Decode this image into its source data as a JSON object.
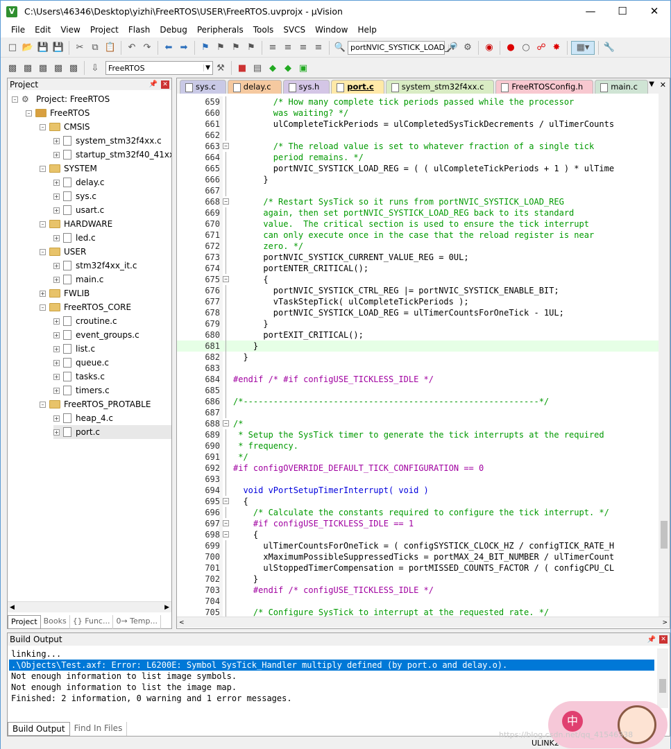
{
  "window": {
    "title": "C:\\Users\\46346\\Desktop\\yizhi\\FreeRTOS\\USER\\FreeRTOS.uvprojx - µVision",
    "app_icon": "V"
  },
  "menu": [
    "File",
    "Edit",
    "View",
    "Project",
    "Flash",
    "Debug",
    "Peripherals",
    "Tools",
    "SVCS",
    "Window",
    "Help"
  ],
  "toolbar": {
    "find_combo": "portNVIC_SYSTICK_LOAD_",
    "target_combo": "FreeRTOS"
  },
  "project": {
    "title": "Project",
    "root": "Project: FreeRTOS",
    "target": "FreeRTOS",
    "tree": [
      {
        "label": "CMSIS",
        "type": "folder",
        "level": 2
      },
      {
        "label": "system_stm32f4xx.c",
        "type": "file",
        "level": 3
      },
      {
        "label": "startup_stm32f40_41xxx.s",
        "type": "file",
        "level": 3
      },
      {
        "label": "SYSTEM",
        "type": "folder",
        "level": 2
      },
      {
        "label": "delay.c",
        "type": "file",
        "level": 3
      },
      {
        "label": "sys.c",
        "type": "file",
        "level": 3
      },
      {
        "label": "usart.c",
        "type": "file",
        "level": 3
      },
      {
        "label": "HARDWARE",
        "type": "folder",
        "level": 2
      },
      {
        "label": "led.c",
        "type": "file",
        "level": 3
      },
      {
        "label": "USER",
        "type": "folder",
        "level": 2
      },
      {
        "label": "stm32f4xx_it.c",
        "type": "file",
        "level": 3
      },
      {
        "label": "main.c",
        "type": "file",
        "level": 3
      },
      {
        "label": "FWLIB",
        "type": "folder",
        "level": 2
      },
      {
        "label": "FreeRTOS_CORE",
        "type": "folder",
        "level": 2
      },
      {
        "label": "croutine.c",
        "type": "file",
        "level": 3
      },
      {
        "label": "event_groups.c",
        "type": "file",
        "level": 3
      },
      {
        "label": "list.c",
        "type": "file",
        "level": 3
      },
      {
        "label": "queue.c",
        "type": "file",
        "level": 3
      },
      {
        "label": "tasks.c",
        "type": "file",
        "level": 3
      },
      {
        "label": "timers.c",
        "type": "file",
        "level": 3
      },
      {
        "label": "FreeRTOS_PROTABLE",
        "type": "folder",
        "level": 2
      },
      {
        "label": "heap_4.c",
        "type": "file",
        "level": 3
      },
      {
        "label": "port.c",
        "type": "file",
        "level": 3
      }
    ],
    "tabs": [
      "Project",
      "Books",
      "{} Func...",
      "0→ Temp..."
    ]
  },
  "editor": {
    "tabs": [
      {
        "label": "sys.c",
        "color": "#c9c9e6"
      },
      {
        "label": "delay.c",
        "color": "#f5c9a0"
      },
      {
        "label": "sys.h",
        "color": "#d4c6e6"
      },
      {
        "label": "port.c",
        "color": "#ffe9a8"
      },
      {
        "label": "system_stm32f4xx.c",
        "color": "#d9ecc4"
      },
      {
        "label": "FreeRTOSConfig.h",
        "color": "#f8c8d0"
      },
      {
        "label": "main.c",
        "color": "#cfe4d4"
      }
    ],
    "lines": [
      {
        "n": "659",
        "code": "        /* How many complete tick periods passed while the processor",
        "c": "cmt"
      },
      {
        "n": "660",
        "code": "        was waiting? */",
        "c": "cmt"
      },
      {
        "n": "661",
        "code": "        ulCompleteTickPeriods = ulCompletedSysTickDecrements / ulTimerCounts",
        "c": ""
      },
      {
        "n": "662",
        "code": "",
        "c": ""
      },
      {
        "n": "663",
        "code": "        /* The reload value is set to whatever fraction of a single tick",
        "c": "cmt",
        "fold": "-"
      },
      {
        "n": "664",
        "code": "        period remains. */",
        "c": "cmt"
      },
      {
        "n": "665",
        "code": "        portNVIC_SYSTICK_LOAD_REG = ( ( ulCompleteTickPeriods + 1 ) * ulTime",
        "c": ""
      },
      {
        "n": "666",
        "code": "      }",
        "c": ""
      },
      {
        "n": "667",
        "code": "",
        "c": ""
      },
      {
        "n": "668",
        "code": "      /* Restart SysTick so it runs from portNVIC_SYSTICK_LOAD_REG",
        "c": "cmt",
        "fold": "-"
      },
      {
        "n": "669",
        "code": "      again, then set portNVIC_SYSTICK_LOAD_REG back to its standard",
        "c": "cmt"
      },
      {
        "n": "670",
        "code": "      value.  The critical section is used to ensure the tick interrupt",
        "c": "cmt"
      },
      {
        "n": "671",
        "code": "      can only execute once in the case that the reload register is near",
        "c": "cmt"
      },
      {
        "n": "672",
        "code": "      zero. */",
        "c": "cmt"
      },
      {
        "n": "673",
        "code": "      portNVIC_SYSTICK_CURRENT_VALUE_REG = 0UL;",
        "c": ""
      },
      {
        "n": "674",
        "code": "      portENTER_CRITICAL();",
        "c": ""
      },
      {
        "n": "675",
        "code": "      {",
        "c": "",
        "fold": "-"
      },
      {
        "n": "676",
        "code": "        portNVIC_SYSTICK_CTRL_REG |= portNVIC_SYSTICK_ENABLE_BIT;",
        "c": ""
      },
      {
        "n": "677",
        "code": "        vTaskStepTick( ulCompleteTickPeriods );",
        "c": ""
      },
      {
        "n": "678",
        "code": "        portNVIC_SYSTICK_LOAD_REG = ulTimerCountsForOneTick - 1UL;",
        "c": ""
      },
      {
        "n": "679",
        "code": "      }",
        "c": ""
      },
      {
        "n": "680",
        "code": "      portEXIT_CRITICAL();",
        "c": ""
      },
      {
        "n": "681",
        "code": "    }",
        "c": "",
        "hl": true
      },
      {
        "n": "682",
        "code": "  }",
        "c": ""
      },
      {
        "n": "683",
        "code": "",
        "c": ""
      },
      {
        "n": "684",
        "code": "#endif /* #if configUSE_TICKLESS_IDLE */",
        "c": "pp"
      },
      {
        "n": "685",
        "code": "",
        "c": ""
      },
      {
        "n": "686",
        "code": "/*-----------------------------------------------------------*/",
        "c": "cmt"
      },
      {
        "n": "687",
        "code": "",
        "c": ""
      },
      {
        "n": "688",
        "code": "/*",
        "c": "cmt",
        "fold": "-"
      },
      {
        "n": "689",
        "code": " * Setup the SysTick timer to generate the tick interrupts at the required",
        "c": "cmt"
      },
      {
        "n": "690",
        "code": " * frequency.",
        "c": "cmt"
      },
      {
        "n": "691",
        "code": " */",
        "c": "cmt"
      },
      {
        "n": "692",
        "code": "#if configOVERRIDE_DEFAULT_TICK_CONFIGURATION == 0",
        "c": "pp"
      },
      {
        "n": "693",
        "code": "",
        "c": ""
      },
      {
        "n": "694",
        "code": "  void vPortSetupTimerInterrupt( void )",
        "c": "kwline"
      },
      {
        "n": "695",
        "code": "  {",
        "c": "",
        "fold": "-"
      },
      {
        "n": "696",
        "code": "    /* Calculate the constants required to configure the tick interrupt. */",
        "c": "cmt"
      },
      {
        "n": "697",
        "code": "    #if configUSE_TICKLESS_IDLE == 1",
        "c": "pp",
        "fold": "-"
      },
      {
        "n": "698",
        "code": "    {",
        "c": "",
        "fold": "-"
      },
      {
        "n": "699",
        "code": "      ulTimerCountsForOneTick = ( configSYSTICK_CLOCK_HZ / configTICK_RATE_H",
        "c": ""
      },
      {
        "n": "700",
        "code": "      xMaximumPossibleSuppressedTicks = portMAX_24_BIT_NUMBER / ulTimerCount",
        "c": ""
      },
      {
        "n": "701",
        "code": "      ulStoppedTimerCompensation = portMISSED_COUNTS_FACTOR / ( configCPU_CL",
        "c": ""
      },
      {
        "n": "702",
        "code": "    }",
        "c": ""
      },
      {
        "n": "703",
        "code": "    #endif /* configUSE_TICKLESS_IDLE */",
        "c": "pp"
      },
      {
        "n": "704",
        "code": "",
        "c": ""
      },
      {
        "n": "705",
        "code": "    /* Configure SysTick to interrupt at the requested rate. */",
        "c": "cmt"
      }
    ]
  },
  "build": {
    "title": "Build Output",
    "lines": [
      "linking...",
      ".\\Objects\\Test.axf: Error: L6200E: Symbol SysTick_Handler multiply defined (by port.o and delay.o).",
      "Not enough information to list image symbols.",
      "Not enough information to list the image map.",
      "Finished: 2 information, 0 warning and 1 error messages."
    ],
    "selected_line": 1,
    "tabs": [
      "Build Output",
      "Find In Files"
    ]
  },
  "status": {
    "right": "ULINK2"
  },
  "watermark": "https://blog.csdn.net/qq_41546338",
  "avatar_text": "中"
}
